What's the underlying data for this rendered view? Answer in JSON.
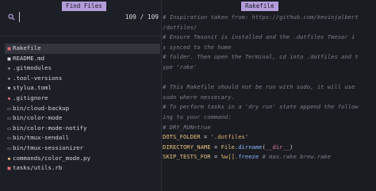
{
  "left_panel": {
    "title": "Find Files",
    "search": {
      "value": "",
      "placeholder": ""
    },
    "counter": "109 / 109",
    "files": [
      {
        "name": "Rakefile",
        "icon": "ruby-icon",
        "icon_glyph": "■",
        "icon_color": "#e06c75",
        "selected": true
      },
      {
        "name": "README.md",
        "icon": "markdown-icon",
        "icon_glyph": "■",
        "icon_color": "#d4d6dc"
      },
      {
        "name": ".gitmodules",
        "icon": "git-icon",
        "icon_glyph": "◆",
        "icon_color": "#7b7f8a"
      },
      {
        "name": ".tool-versions",
        "icon": "gear-icon",
        "icon_glyph": "◆",
        "icon_color": "#7b7f8a"
      },
      {
        "name": "stylua.toml",
        "icon": "gear-icon",
        "icon_glyph": "✱",
        "icon_color": "#d4d6dc"
      },
      {
        "name": ".gitignore",
        "icon": "git-icon",
        "icon_glyph": "◆",
        "icon_color": "#e06c75"
      },
      {
        "name": "bin/cloud-backup",
        "icon": "file-icon",
        "icon_glyph": "▭",
        "icon_color": "#aab0ba"
      },
      {
        "name": "bin/color-mode",
        "icon": "file-icon",
        "icon_glyph": "▭",
        "icon_color": "#aab0ba"
      },
      {
        "name": "bin/color-mode-notify",
        "icon": "file-icon",
        "icon_glyph": "▭",
        "icon_color": "#aab0ba"
      },
      {
        "name": "bin/tmux-sendall",
        "icon": "file-icon",
        "icon_glyph": "▭",
        "icon_color": "#aab0ba"
      },
      {
        "name": "bin/tmux-sessionizer",
        "icon": "file-icon",
        "icon_glyph": "▭",
        "icon_color": "#aab0ba"
      },
      {
        "name": "commands/color_mode.py",
        "icon": "python-icon",
        "icon_glyph": "◆",
        "icon_color": "#e5c07b"
      },
      {
        "name": "tasks/utils.rb",
        "icon": "ruby-icon",
        "icon_glyph": "■",
        "icon_color": "#e06c75"
      }
    ]
  },
  "right_panel": {
    "title": "Rakefile",
    "code_lines": [
      [
        {
          "t": "#     Inspiration taken from: https://github.com/kevinjalbert",
          "c": "cmt"
        }
      ],
      [
        {
          "t": "/dotfiles/",
          "c": "cmt"
        }
      ],
      [
        {
          "t": "#     Ensure Tmsonit is installed and the .dotfiles Tmesor i",
          "c": "cmt"
        }
      ],
      [
        {
          "t": "s synced to the home",
          "c": "cmt"
        }
      ],
      [
        {
          "t": "#     folder. Then open the Terminal, cd into .dotfiles and t",
          "c": "cmt"
        }
      ],
      [
        {
          "t": "ype 'rake'",
          "c": "cmt"
        }
      ],
      [
        {
          "t": "",
          "c": "cmt"
        }
      ],
      [
        {
          "t": "#     This Rakefile should not be run with sudo, it will use",
          "c": "cmt"
        }
      ],
      [
        {
          "t": "sudo where nessecary.",
          "c": "cmt"
        }
      ],
      [
        {
          "t": "#     To perform tasks in a 'dry run' state append the follow",
          "c": "cmt"
        }
      ],
      [
        {
          "t": "ing to your command:",
          "c": "cmt"
        }
      ],
      [
        {
          "t": "#       DRY_RUN=true",
          "c": "cmt"
        }
      ],
      [
        {
          "t": "DOTS_FOLDER",
          "c": "k-yel"
        },
        {
          "t": " = ",
          "c": "k-wht"
        },
        {
          "t": "'.dotfiles'",
          "c": "k-str"
        }
      ],
      [
        {
          "t": "DIRECTORY_NAME",
          "c": "k-yel"
        },
        {
          "t": " = ",
          "c": "k-wht"
        },
        {
          "t": "File",
          "c": "k-yel"
        },
        {
          "t": ".",
          "c": "k-wht"
        },
        {
          "t": "dirname",
          "c": "k-blue"
        },
        {
          "t": "(",
          "c": "k-wht"
        },
        {
          "t": "__dir__",
          "c": "k-pink"
        },
        {
          "t": ")",
          "c": "k-wht"
        }
      ],
      [
        {
          "t": "SKIP_TESTS_FOR",
          "c": "k-yel"
        },
        {
          "t": " = ",
          "c": "k-wht"
        },
        {
          "t": "%w[",
          "c": "k-str"
        },
        {
          "t": "].",
          "c": "k-str"
        },
        {
          "t": "freeze",
          "c": "k-blue"
        },
        {
          "t": " # mas.rake brew.rake",
          "c": "cmt"
        }
      ]
    ]
  }
}
